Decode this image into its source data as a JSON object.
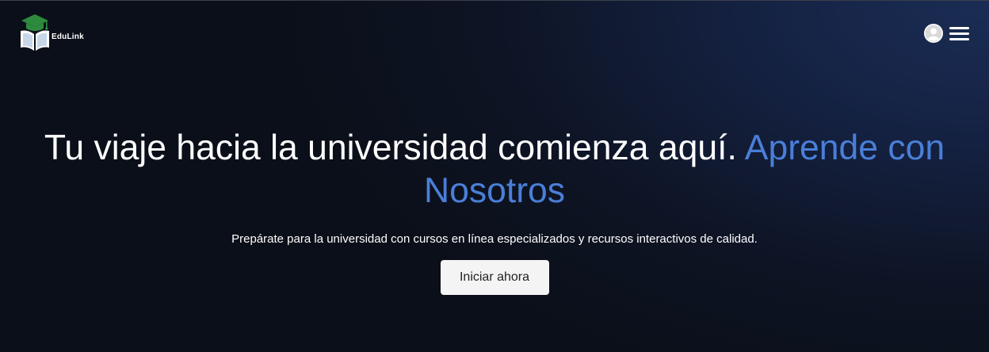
{
  "brand": {
    "name": "EduLink",
    "logo_icon": "graduation-cap-book-icon",
    "colors": {
      "cap": "#2e8b3e",
      "book": "#ffffff"
    }
  },
  "nav": {
    "avatar_icon": "user-avatar-icon",
    "menu_icon": "hamburger-menu-icon"
  },
  "hero": {
    "headline_main": "Tu viaje hacia la universidad comienza aquí. ",
    "headline_accent": "Aprende con Nosotros",
    "subtitle": "Prepárate para la universidad con cursos en línea especializados y recursos interactivos de calidad.",
    "cta_label": "Iniciar ahora"
  },
  "colors": {
    "background": "#0b0f19",
    "accent": "#4a7fd8",
    "button_bg": "#f4f4f4"
  }
}
